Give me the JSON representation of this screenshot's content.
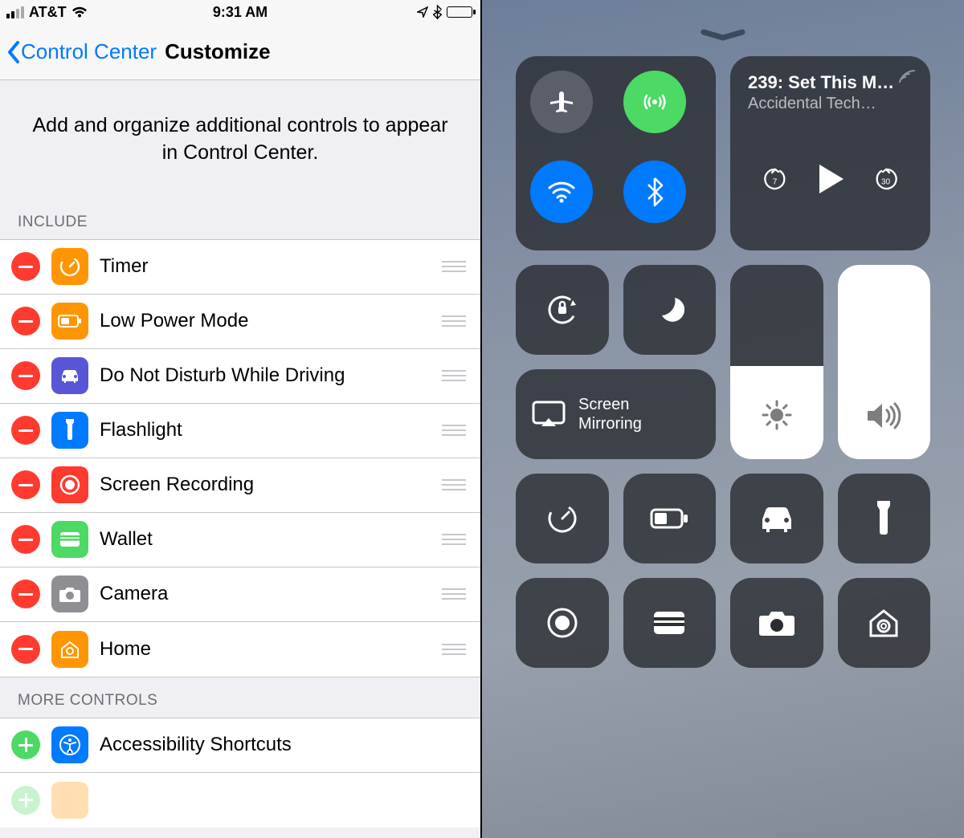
{
  "statusbar": {
    "carrier": "AT&T",
    "time": "9:31 AM"
  },
  "navbar": {
    "back_label": "Control Center",
    "title": "Customize"
  },
  "prompt": "Add and organize additional controls to appear in Control Center.",
  "sections": {
    "include_header": "INCLUDE",
    "more_header": "MORE CONTROLS"
  },
  "include": [
    {
      "label": "Timer"
    },
    {
      "label": "Low Power Mode"
    },
    {
      "label": "Do Not Disturb While Driving"
    },
    {
      "label": "Flashlight"
    },
    {
      "label": "Screen Recording"
    },
    {
      "label": "Wallet"
    },
    {
      "label": "Camera"
    },
    {
      "label": "Home"
    }
  ],
  "more": [
    {
      "label": "Accessibility Shortcuts"
    }
  ],
  "cc": {
    "media_title": "239: Set This M…",
    "media_subtitle": "Accidental Tech…",
    "skip_back": "7",
    "skip_fwd": "30",
    "mirror_label": "Screen\nMirroring",
    "brightness_pct": 48,
    "volume_pct": 100
  }
}
